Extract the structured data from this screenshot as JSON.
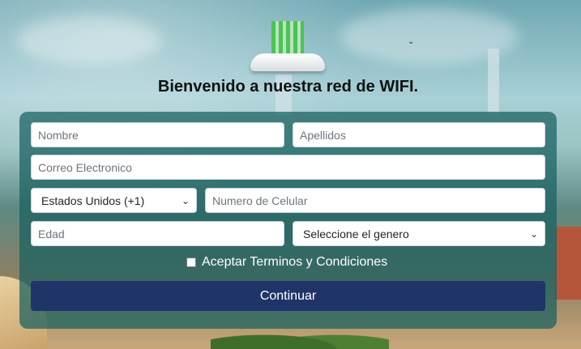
{
  "header": {
    "title": "Bienvenido a nuestra red de WIFI."
  },
  "form": {
    "first_name_placeholder": "Nombre",
    "last_name_placeholder": "Apellidos",
    "email_placeholder": "Correo Electronico",
    "country_selected": "Estados Unidos (+1)",
    "phone_placeholder": "Numero de Celular",
    "age_placeholder": "Edad",
    "gender_selected": "Seleccione el genero",
    "terms_label": "Aceptar Terminos y Condiciones",
    "submit_label": "Continuar"
  },
  "colors": {
    "panel": "#185f60",
    "button": "#1f3569"
  }
}
